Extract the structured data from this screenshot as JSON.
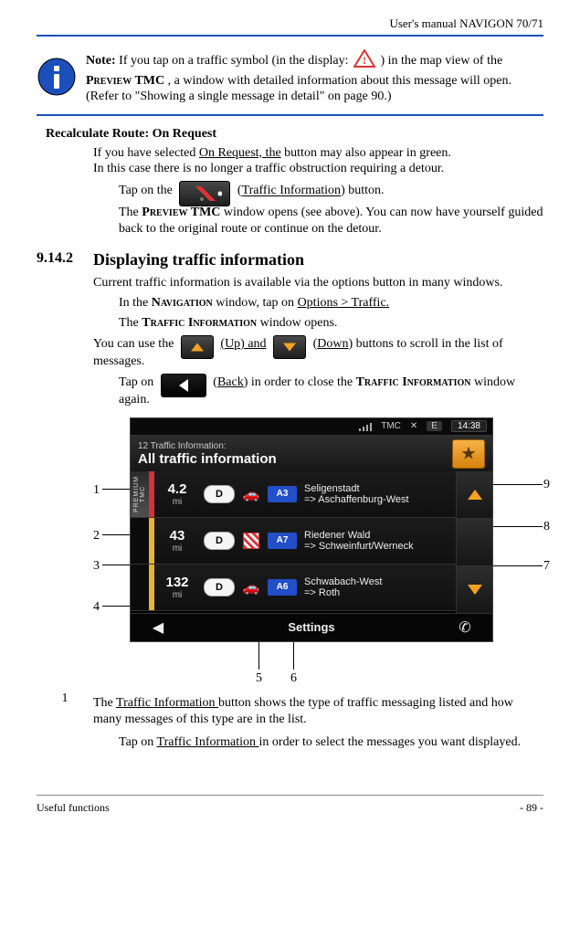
{
  "header": {
    "manual_title": "User's manual NAVIGON 70/71"
  },
  "note": {
    "label": "Note:",
    "text_a": " If you tap on a traffic symbol (in the display: ",
    "text_b": ") in the map view of the ",
    "preview_tmc": "Preview TMC",
    "text_c": ", a window with detailed information about this message will open. (Refer to \"Showing a single message in detail\" on page 90.)"
  },
  "recalc": {
    "heading": "Recalculate Route: On Request",
    "p1a": "If you have selected ",
    "p1_link": "On Request, the",
    "p1b": " button may also appear in green.",
    "p2": "In this case there is no longer a traffic obstruction requiring a detour.",
    "tap_a": "Tap on the ",
    "tap_b_open": " (",
    "tap_link": "Traffic Information",
    "tap_b_close": ") button.",
    "p3a": "The ",
    "p3_sc": "Preview TMC",
    "p3b": " window opens (see above). You can now have yourself guided back to the original route or continue on the detour."
  },
  "section": {
    "num": "9.14.2",
    "title": "Displaying traffic information",
    "intro": "Current traffic information is available via the options button in many windows.",
    "nav_a": "In the ",
    "nav_sc": "Navigation",
    "nav_b": " window, tap on ",
    "nav_link": "Options > Traffic.",
    "open_a": "The ",
    "open_sc": "Traffic Information",
    "open_b": " window opens.",
    "scroll_a": "You can use the ",
    "scroll_up": " (Up) and",
    "scroll_down_open": " (",
    "scroll_down": "Down",
    "scroll_b": ") buttons to scroll in the list of messages.",
    "back_a": "Tap on ",
    "back_open": " (",
    "back_link": "Back",
    "back_b": ") in order to close the ",
    "back_sc": "Traffic Information",
    "back_c": " window again."
  },
  "screenshot": {
    "status": {
      "tmc": "TMC",
      "compass": "E",
      "time": "14:38"
    },
    "title_small": "12 Traffic Information:",
    "title_big": "All traffic information",
    "premium_label": "PREMIUM TMC",
    "rows": [
      {
        "sev": "red",
        "dist": "4.2",
        "unit": "mi",
        "pill": "D",
        "icon": "car",
        "road": "A3",
        "line1": "Seligenstadt",
        "line2": "=> Aschaffenburg-West"
      },
      {
        "sev": "yel",
        "dist": "43",
        "unit": "mi",
        "pill": "D",
        "icon": "construction",
        "road": "A7",
        "line1": "Riedener Wald",
        "line2": "=> Schweinfurt/Werneck"
      },
      {
        "sev": "yel",
        "dist": "132",
        "unit": "mi",
        "pill": "D",
        "icon": "car",
        "road": "A6",
        "line1": "Schwabach-West",
        "line2": "=> Roth"
      }
    ],
    "settings_label": "Settings"
  },
  "callouts": {
    "c1": "1",
    "c2": "2",
    "c3": "3",
    "c4": "4",
    "c5": "5",
    "c6": "6",
    "c7": "7",
    "c8": "8",
    "c9": "9"
  },
  "item1": {
    "num": "1",
    "a": "The ",
    "link": "Traffic Information ",
    "b": "button shows the type of traffic messaging listed and how many messages of this type are in the list.",
    "tap_a": "Tap on ",
    "tap_link": "Traffic Information ",
    "tap_b": "in order to select the messages you want displayed."
  },
  "footer": {
    "left": "Useful functions",
    "right": "- 89 -"
  }
}
